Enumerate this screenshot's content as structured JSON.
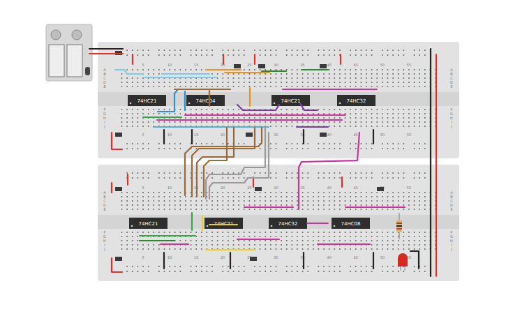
{
  "boards": [
    {
      "chips": [
        {
          "label": "74HC21"
        },
        {
          "label": "74HC04"
        },
        {
          "label": "74HC21"
        },
        {
          "label": "74HC32"
        }
      ]
    },
    {
      "chips": [
        {
          "label": "74HC21"
        },
        {
          "label": "74HC21"
        },
        {
          "label": "74HC32"
        },
        {
          "label": "74HC08"
        }
      ]
    }
  ],
  "column_numbers": [
    "5",
    "10",
    "15",
    "20",
    "25",
    "30",
    "35",
    "40",
    "45",
    "50",
    "55"
  ],
  "row_letters": [
    "A",
    "B",
    "C",
    "D",
    "E",
    "F",
    "G",
    "H",
    "I",
    "J"
  ],
  "led": {
    "color": "#d42a24"
  },
  "wires": [
    {
      "color": "#222222"
    },
    {
      "color": "#e0322a"
    },
    {
      "color": "#222222"
    },
    {
      "color": "#e0322a"
    },
    {
      "color": "#e0322a"
    },
    {
      "color": "#e0322a"
    },
    {
      "color": "#e0322a"
    },
    {
      "color": "#e0322a"
    },
    {
      "color": "#e0322a"
    },
    {
      "color": "#222222"
    },
    {
      "color": "#222222"
    },
    {
      "color": "#222222"
    },
    {
      "color": "#222222"
    },
    {
      "color": "#e0322a"
    },
    {
      "color": "#e0322a"
    },
    {
      "color": "#e0322a"
    },
    {
      "color": "#222222"
    },
    {
      "color": "#222222"
    },
    {
      "color": "#222222"
    },
    {
      "color": "#222222"
    },
    {
      "color": "#222222"
    },
    {
      "color": "#e0322a"
    },
    {
      "color": "#e0322a"
    },
    {
      "color": "#7ec8e8"
    },
    {
      "color": "#7ec8e8"
    },
    {
      "color": "#7ec8e8"
    },
    {
      "color": "#f0901e"
    },
    {
      "color": "#f0901e"
    },
    {
      "color": "#f0901e"
    },
    {
      "color": "#2c8a2c"
    },
    {
      "color": "#2c8a2c"
    },
    {
      "color": "#2d8fd8"
    },
    {
      "color": "#2d8fd8"
    },
    {
      "color": "#9a6a3a"
    },
    {
      "color": "#9a6a3a"
    },
    {
      "color": "#7a3aa8"
    },
    {
      "color": "#7a3aa8"
    },
    {
      "color": "#d2309a"
    },
    {
      "color": "#d2309a"
    },
    {
      "color": "#d2309a"
    },
    {
      "color": "#35a845"
    },
    {
      "color": "#4fb0e0"
    },
    {
      "color": "#7a3aa8"
    },
    {
      "color": "#9a6a3a"
    },
    {
      "color": "#9a6a3a"
    },
    {
      "color": "#9a6a3a"
    },
    {
      "color": "#9a6a3a"
    },
    {
      "color": "#9a9a9a"
    },
    {
      "color": "#9a9a9a"
    },
    {
      "color": "#d2309a"
    },
    {
      "color": "#35a845"
    },
    {
      "color": "#35a845"
    },
    {
      "color": "#2c8a2c"
    },
    {
      "color": "#e8d020"
    },
    {
      "color": "#e8d020"
    },
    {
      "color": "#e8d020"
    },
    {
      "color": "#d2309a"
    },
    {
      "color": "#d2309a"
    },
    {
      "color": "#d2309a"
    },
    {
      "color": "#d2309a"
    },
    {
      "color": "#d2309a"
    },
    {
      "color": "#d2309a"
    }
  ]
}
